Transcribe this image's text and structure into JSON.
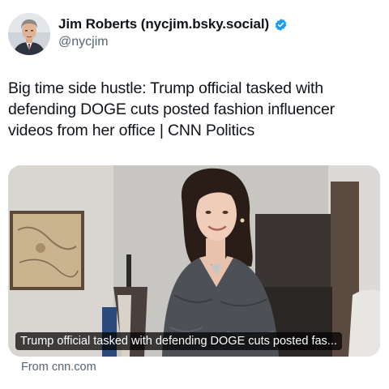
{
  "author": {
    "display_name": "Jim Roberts (nycjim.bsky.social)",
    "handle": "@nycjim",
    "verified": true,
    "verified_color": "#1d9bf0"
  },
  "tweet": {
    "text": "Big time side hustle: Trump official tasked with defending DOGE cuts posted fashion influencer videos from her office | CNN Politics"
  },
  "card": {
    "caption": "Trump official tasked with defending DOGE cuts posted fas...",
    "source": "From cnn.com"
  },
  "colors": {
    "text_primary": "#0f1419",
    "text_secondary": "#536471",
    "accent": "#1d9bf0"
  }
}
